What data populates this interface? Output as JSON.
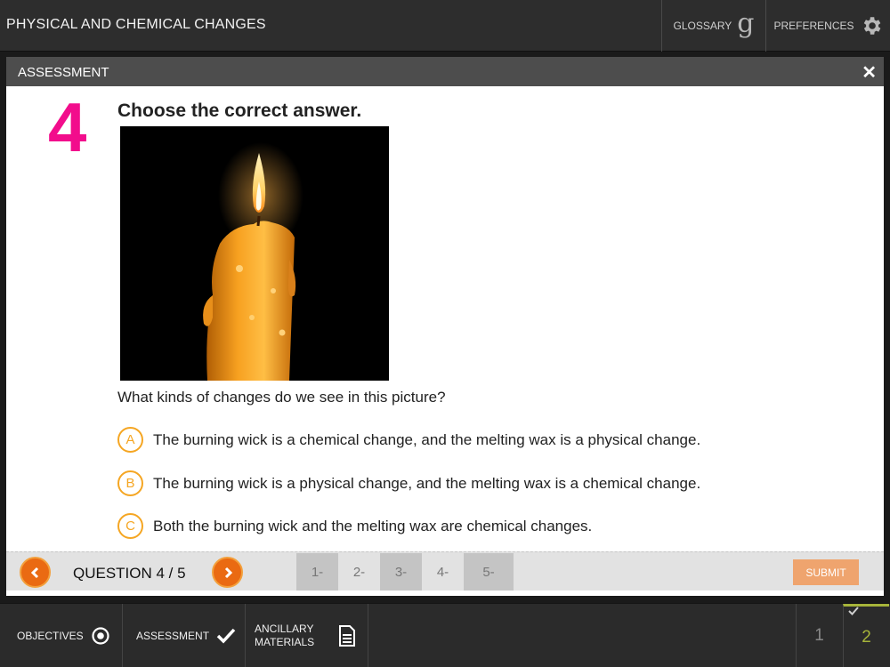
{
  "app": {
    "title": "PHYSICAL AND CHEMICAL CHANGES",
    "glossary_label": "GLOSSARY",
    "glossary_icon": "g",
    "preferences_label": "PREFERENCES"
  },
  "modal": {
    "title": "ASSESSMENT",
    "close_symbol": "✕"
  },
  "question": {
    "number": "4",
    "heading": "Choose the correct answer.",
    "prompt": "What kinds of changes do we see in this picture?",
    "options": [
      {
        "letter": "A",
        "text": "The burning wick is a chemical change, and the melting wax is a physical change."
      },
      {
        "letter": "B",
        "text": "The burning wick is a physical change, and the melting wax is a chemical change."
      },
      {
        "letter": "C",
        "text": "Both the burning wick and the melting wax are chemical changes."
      }
    ]
  },
  "qnav": {
    "counter": "QUESTION 4 / 5",
    "tabs": [
      "1-",
      "2-",
      "3-",
      "4-",
      "5-"
    ],
    "submit_label": "SUBMIT"
  },
  "bottom": {
    "objectives_label": "OBJECTIVES",
    "assessment_label": "ASSESSMENT",
    "ancillary_label_line1": "ANCILLARY",
    "ancillary_label_line2": "MATERIALS",
    "pages": [
      "1",
      "2"
    ]
  },
  "colors": {
    "accent_orange": "#ea6a12",
    "option_ring": "#f5a623",
    "question_number": "#f20d8c",
    "active_page": "#a6b43a"
  }
}
